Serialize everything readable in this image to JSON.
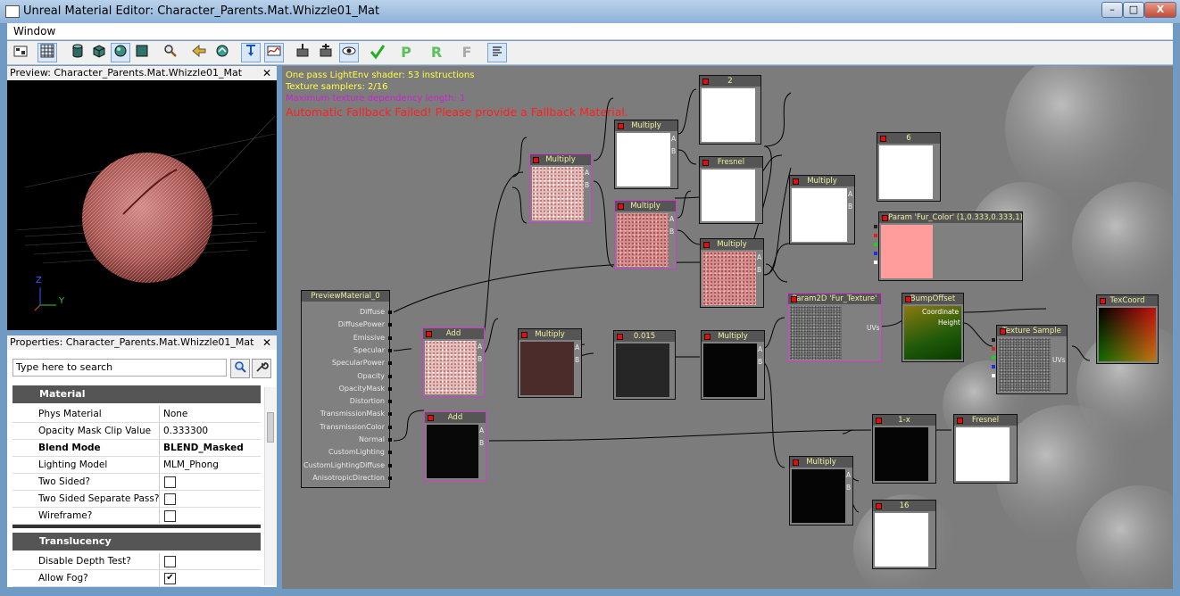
{
  "window": {
    "title": "Unreal Material Editor: Character_Parents.Mat.Whizzle01_Mat",
    "minimize": "–",
    "maximize": "□",
    "close": "X"
  },
  "menu": {
    "window_label": "Window"
  },
  "toolbar": {
    "buttons": [
      "scene-icon",
      "grid-icon",
      "cylinder-icon",
      "cube-icon",
      "sphere-icon",
      "plane-icon",
      "magnify-icon",
      "back-arrow-icon",
      "home-icon",
      "expression-icon",
      "curve-icon",
      "node-in-icon",
      "node-out-icon",
      "eye-icon",
      "apply-check-icon",
      "P",
      "R",
      "F",
      "text-icon"
    ],
    "P": "P",
    "R": "R",
    "F": "F"
  },
  "preview": {
    "title": "Preview: Character_Parents.Mat.Whizzle01_Mat",
    "close": "✕",
    "axis_z": "Z",
    "axis_y": "Y"
  },
  "properties": {
    "title": "Properties: Character_Parents.Mat.Whizzle01_Mat",
    "close": "✕",
    "search_placeholder": "Type here to search",
    "categories": [
      {
        "name": "Material",
        "rows": [
          {
            "key": "Phys Material",
            "value": "None"
          },
          {
            "key": "Opacity Mask Clip Value",
            "value": "0.333300"
          },
          {
            "key": "Blend Mode",
            "value": "BLEND_Masked",
            "bold": true
          },
          {
            "key": "Lighting Model",
            "value": "MLM_Phong"
          },
          {
            "key": "Two Sided?",
            "checkbox": false
          },
          {
            "key": "Two Sided Separate Pass?",
            "checkbox": false
          },
          {
            "key": "Wireframe?",
            "checkbox": false
          }
        ]
      },
      {
        "name": "Translucency",
        "rows": [
          {
            "key": "Disable Depth Test?",
            "checkbox": false
          },
          {
            "key": "Allow Fog?",
            "checkbox": true
          }
        ]
      }
    ]
  },
  "graph": {
    "stats": [
      {
        "text": "One pass LightEnv shader: 53 instructions",
        "color": "#ffff40"
      },
      {
        "text": "Texture samplers: 2/16",
        "color": "#ffff40"
      },
      {
        "text": "Maximum texture dependency length: 1",
        "color": "#d020d0"
      },
      {
        "text": "Automatic Fallback Failed! Please provide a Fallback Material.",
        "color": "#ff2020"
      }
    ],
    "material_node": {
      "title": "PreviewMaterial_0",
      "inputs": [
        "Diffuse",
        "DiffusePower",
        "Emissive",
        "Specular",
        "SpecularPower",
        "Opacity",
        "OpacityMask",
        "Distortion",
        "TransmissionMask",
        "TransmissionColor",
        "Normal",
        "CustomLighting",
        "CustomLightingDiffuse",
        "AnisotropicDirection"
      ]
    },
    "node_labels": {
      "const_2": "2",
      "multiply": "Multiply",
      "fresnel": "Fresnel",
      "const_6": "6",
      "add": "Add",
      "const_0015": "0.015",
      "param_fur_color": "Param 'Fur_Color' (1,0.333,0.333,1)",
      "param_fur_texture": "Param2D 'Fur_Texture'",
      "bump_offset": "BumpOffset",
      "texture_sample": "Texture Sample",
      "tex_coord": "TexCoord",
      "one_minus": "1-x",
      "const_16": "16",
      "pin_a": "A",
      "pin_b": "B",
      "pin_uvs": "UVs",
      "pin_coordinate": "Coordinate",
      "pin_height": "Height"
    }
  },
  "colors": {
    "canvas": "#7c7c7c",
    "selected_border": "#d23bd0",
    "node_header": "#555555",
    "fur_color": "#ff9c9c"
  }
}
